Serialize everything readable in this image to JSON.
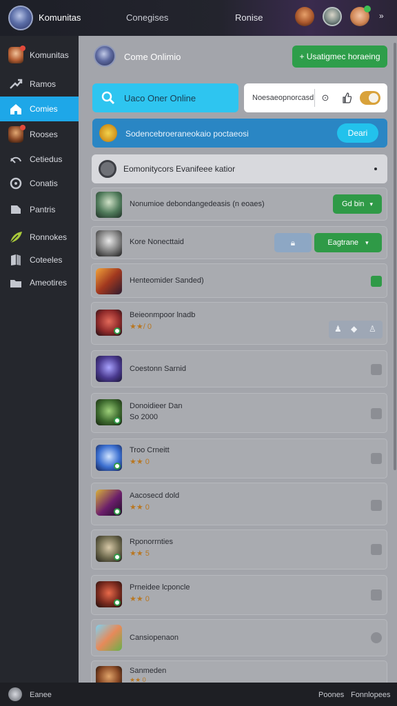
{
  "topbar": {
    "title": "Komunitas",
    "middle": "Conegises",
    "right": "Ronise",
    "more": "»"
  },
  "sidebar": {
    "items": [
      {
        "label": "Komunitas",
        "icon": "community-avatar-icon"
      },
      {
        "label": "Ramos",
        "icon": "trend-arrow-icon"
      },
      {
        "label": "Comies",
        "icon": "home-icon"
      },
      {
        "label": "Rooses",
        "icon": "character-avatar-icon"
      },
      {
        "label": "Cetiedus",
        "icon": "controller-icon"
      },
      {
        "label": "Conatis",
        "icon": "shield-icon"
      },
      {
        "label": "Pantris",
        "icon": "document-icon"
      },
      {
        "label": "Ronnokes",
        "icon": "leaf-icon"
      },
      {
        "label": "Coteeles",
        "icon": "book-icon"
      },
      {
        "label": "Ameotires",
        "icon": "folder-icon"
      }
    ]
  },
  "main": {
    "header_title": "Come Onlimio",
    "header_button": "+ Usatigmec horaeing",
    "search_text": "Uaco Oner Online",
    "search_box_text": "Noesaeopnorcasd",
    "banner_text": "Sodencebroeraneokaio  poctaeosi",
    "banner_button": "Deari",
    "section_title": "Eomonitycors  Evanifeee  katior",
    "section_dot": "•"
  },
  "rows": [
    {
      "title": "Nonumioe debondangedeasis (n eoaes)",
      "action_label": "Gd bin"
    },
    {
      "title": "Kore Nonecttaid",
      "action_label": "Eagtrane"
    },
    {
      "title": "Henteomider Sanded)"
    },
    {
      "title": "Beieonmpoor lnadb",
      "stars": "★★/ 0"
    },
    {
      "title": "Coestonn Sarnid"
    },
    {
      "title": "Donoidieer Dan",
      "subtitle": "So 2000"
    },
    {
      "title": "Troo Crneitt",
      "stars": "★★ 0"
    },
    {
      "title": "Aacosecd dold",
      "stars": "★★ 0"
    },
    {
      "title": "Rponorrnties",
      "stars": "★★ 5"
    },
    {
      "title": "Prneidee lcponcle",
      "stars": "★★ 0"
    },
    {
      "title": "Cansiopenaon"
    },
    {
      "title": "Sanmeden",
      "stars": "★★ 0"
    }
  ],
  "bottombar": {
    "left": "Eanee",
    "right1": "Poones",
    "right2": "Fonnlopees"
  },
  "colors": {
    "accent_blue": "#1ea7e8",
    "accent_green": "#2e9e4a",
    "sidebar_bg": "#25272d",
    "main_bg": "#a3a5ab"
  }
}
